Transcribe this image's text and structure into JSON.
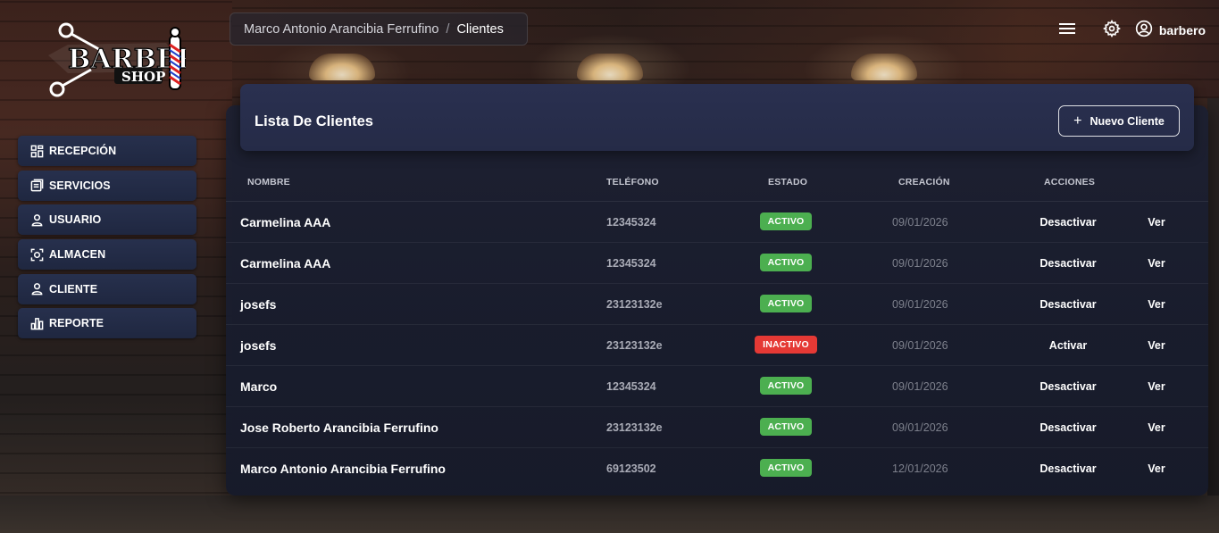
{
  "app": {
    "logo_text_top": "BARBER",
    "logo_text_bottom": "SHOP"
  },
  "breadcrumb": {
    "parent": "Marco Antonio Arancibia Ferrufino",
    "separator": "/",
    "current": "Clientes"
  },
  "topbar": {
    "user_name": "barbero",
    "icons": [
      "menu-icon",
      "gear-icon",
      "user-circle-icon"
    ]
  },
  "sidebar": {
    "items": [
      {
        "label": "RECEPCIÓN",
        "icon": "dashboard-icon"
      },
      {
        "label": "SERVICIOS",
        "icon": "services-icon"
      },
      {
        "label": "USUARIO",
        "icon": "user-icon"
      },
      {
        "label": "ALMACEN",
        "icon": "inventory-icon"
      },
      {
        "label": "CLIENTE",
        "icon": "user-icon"
      },
      {
        "label": "REPORTE",
        "icon": "chart-icon"
      }
    ]
  },
  "main": {
    "title": "Lista De Clientes",
    "new_button_label": "Nuevo Cliente",
    "columns": [
      "NOMBRE",
      "TELÉFONO",
      "ESTADO",
      "CREACIÓN",
      "ACCIONES"
    ],
    "rows": [
      {
        "name": "Carmelina AAA",
        "phone": "12345324",
        "status": "ACTIVO",
        "status_kind": "active",
        "created": "09/01/2026",
        "action": "Desactivar",
        "view": "Ver"
      },
      {
        "name": "Carmelina AAA",
        "phone": "12345324",
        "status": "ACTIVO",
        "status_kind": "active",
        "created": "09/01/2026",
        "action": "Desactivar",
        "view": "Ver"
      },
      {
        "name": "josefs",
        "phone": "23123132e",
        "status": "ACTIVO",
        "status_kind": "active",
        "created": "09/01/2026",
        "action": "Desactivar",
        "view": "Ver"
      },
      {
        "name": "josefs",
        "phone": "23123132e",
        "status": "INACTIVO",
        "status_kind": "inactive",
        "created": "09/01/2026",
        "action": "Activar",
        "view": "Ver"
      },
      {
        "name": "Marco",
        "phone": "12345324",
        "status": "ACTIVO",
        "status_kind": "active",
        "created": "09/01/2026",
        "action": "Desactivar",
        "view": "Ver"
      },
      {
        "name": "Jose Roberto Arancibia Ferrufino",
        "phone": "23123132e",
        "status": "ACTIVO",
        "status_kind": "active",
        "created": "09/01/2026",
        "action": "Desactivar",
        "view": "Ver"
      },
      {
        "name": "Marco Antonio Arancibia Ferrufino",
        "phone": "69123502",
        "status": "ACTIVO",
        "status_kind": "active",
        "created": "12/01/2026",
        "action": "Desactivar",
        "view": "Ver"
      }
    ]
  },
  "colors": {
    "active": "#4caf50",
    "inactive": "#e53935",
    "card": "#1c2032",
    "sidebar_item": "#252d48"
  }
}
